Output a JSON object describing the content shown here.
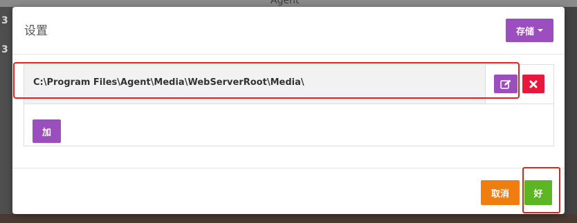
{
  "background": {
    "window_title": "Agent",
    "side_glyphs": [
      "3",
      "3"
    ]
  },
  "dialog": {
    "title": "设置",
    "save_button": {
      "label": "存储",
      "icon": "caret-down-icon"
    },
    "paths": [
      {
        "value": "C:\\Program Files\\Agent\\Media\\WebServerRoot\\Media\\",
        "edit_icon": "edit-icon",
        "delete_icon": "close-icon"
      }
    ],
    "add_button": {
      "label": "加"
    },
    "cancel_button": {
      "label": "取消"
    },
    "ok_button": {
      "label": "好"
    }
  },
  "colors": {
    "purple": "#9b4fbe",
    "red": "#e8173c",
    "orange": "#ef7d12",
    "green": "#5cb624",
    "highlight": "#e2221a"
  }
}
